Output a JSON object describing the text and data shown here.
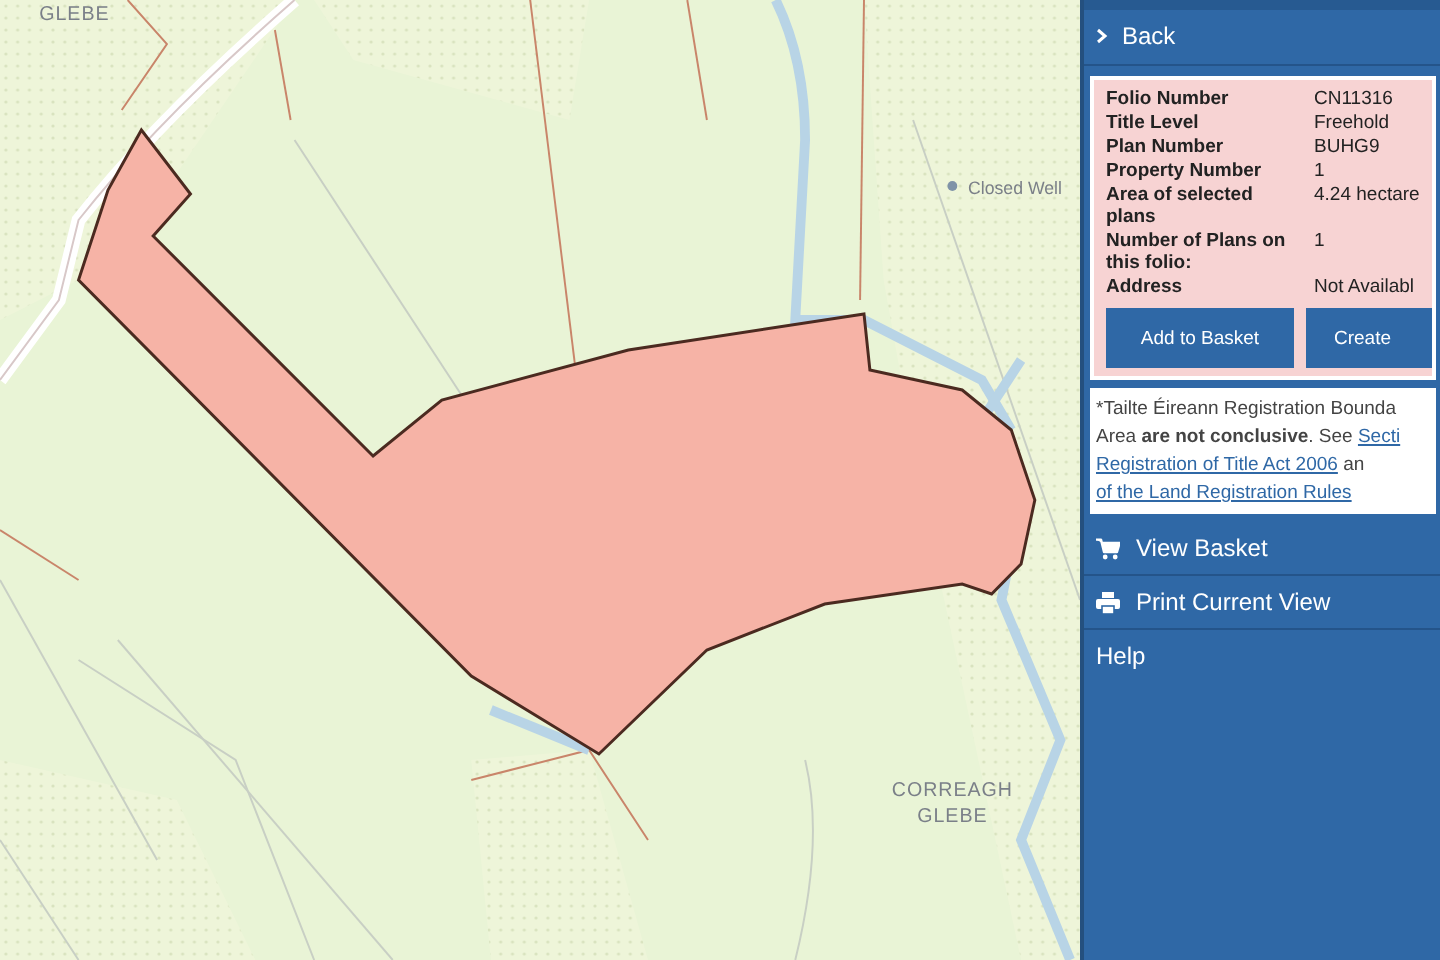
{
  "map": {
    "labels": [
      {
        "kind": "townland",
        "lines": [
          "GLEBE"
        ]
      },
      {
        "kind": "feature",
        "lines": [
          "Closed Well"
        ]
      },
      {
        "kind": "townland",
        "lines": [
          "CORREAGH",
          "GLEBE"
        ]
      }
    ]
  },
  "sidebar": {
    "back": "Back",
    "details": [
      {
        "label": "Folio Number",
        "value": "CN11316"
      },
      {
        "label": "Title Level",
        "value": "Freehold"
      },
      {
        "label": "Plan Number",
        "value": "BUHG9"
      },
      {
        "label": "Property Number",
        "value": "1"
      },
      {
        "label": "Area of selected plans",
        "value": "4.24 hectare"
      },
      {
        "label": "Number of Plans on this folio:",
        "value": "1"
      },
      {
        "label": "Address",
        "value": "Not Availabl"
      }
    ],
    "buttons": [
      "Add to Basket",
      "Create"
    ],
    "note": [
      [
        {
          "kind": "text",
          "text": "*Tailte Éireann Registration Bounda"
        }
      ],
      [
        {
          "kind": "text",
          "text": "Area **are not conclusive**. See "
        },
        {
          "kind": "link",
          "text": "Secti"
        }
      ],
      [
        {
          "kind": "link",
          "text": "Registration of Title Act 2006"
        },
        {
          "kind": "text",
          "text": " an"
        }
      ],
      [
        {
          "kind": "link",
          "text": "of the Land Registration Rules"
        }
      ]
    ],
    "menu": [
      {
        "kind": "cart",
        "label": "View Basket"
      },
      {
        "kind": "print",
        "label": "Print Current View"
      },
      {
        "kind": "plain",
        "label": "Help"
      }
    ]
  }
}
